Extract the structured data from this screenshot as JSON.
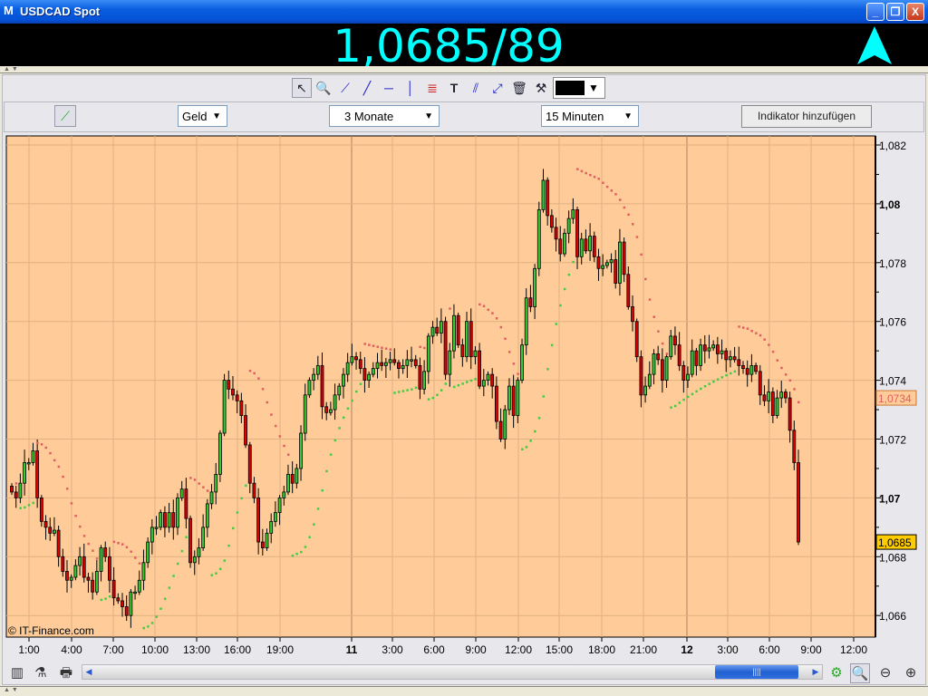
{
  "window": {
    "title": "USDCAD Spot",
    "logo": "M",
    "minimize": "_",
    "restore": "❐",
    "close": "X"
  },
  "quote": {
    "price": "1,0685/89",
    "direction": "up",
    "color": "#00ffff"
  },
  "strip": {
    "arrows": "▲ ▼"
  },
  "toolbar": {
    "icons": [
      "pointer-icon",
      "zoom-icon",
      "line-icon",
      "trend-line-icon",
      "horizontal-line-icon",
      "vertical-line-icon",
      "fibonacci-icon",
      "text-icon",
      "channel-icon",
      "arrow-line-icon",
      "trash-icon",
      "tools-icon"
    ],
    "color_value": "#000000"
  },
  "controls": {
    "price_type": "Geld",
    "range": "3 Monate",
    "interval": "15 Minuten",
    "add_indicator": "Indikator hinzufügen"
  },
  "chart_data": {
    "type": "candlestick",
    "watermark": "© IT-Finance.com",
    "ylim": [
      1.065,
      1.0825
    ],
    "y_ticks": [
      {
        "v": 1.066,
        "label": "1,066"
      },
      {
        "v": 1.068,
        "label": "1,068"
      },
      {
        "v": 1.07,
        "label": "1,07",
        "bold": true
      },
      {
        "v": 1.072,
        "label": "1,072"
      },
      {
        "v": 1.074,
        "label": "1,074"
      },
      {
        "v": 1.076,
        "label": "1,076"
      },
      {
        "v": 1.078,
        "label": "1,078"
      },
      {
        "v": 1.08,
        "label": "1,08",
        "bold": true
      },
      {
        "v": 1.082,
        "label": "1,082"
      }
    ],
    "x_ticks": [
      {
        "label": "1:00"
      },
      {
        "label": "4:00"
      },
      {
        "label": "7:00"
      },
      {
        "label": "10:00"
      },
      {
        "label": "13:00"
      },
      {
        "label": "16:00"
      },
      {
        "label": "19:00"
      },
      {
        "label": "11",
        "bold": true
      },
      {
        "label": "3:00"
      },
      {
        "label": "6:00"
      },
      {
        "label": "9:00"
      },
      {
        "label": "12:00"
      },
      {
        "label": "15:00"
      },
      {
        "label": "18:00"
      },
      {
        "label": "21:00"
      },
      {
        "label": "12",
        "bold": true
      },
      {
        "label": "3:00"
      },
      {
        "label": "6:00"
      },
      {
        "label": "9:00"
      },
      {
        "label": "12:00"
      }
    ],
    "indicator_label": {
      "value": 1.0734,
      "text": "1,0734"
    },
    "last_label": {
      "value": 1.0685,
      "text": "1,0685"
    },
    "overlay": "parabolic-sar",
    "colors": {
      "up": "#33cc33",
      "down": "#dd0000",
      "bg": "#ffcc99",
      "sar_up": "#44cc44",
      "sar_down": "#e06060"
    },
    "closes": [
      1.0702,
      1.07,
      1.0705,
      1.0712,
      1.0712,
      1.0716,
      1.07,
      1.0692,
      1.069,
      1.0688,
      1.0689,
      1.068,
      1.0675,
      1.0672,
      1.0673,
      1.0677,
      1.068,
      1.0673,
      1.0672,
      1.0668,
      1.0675,
      1.0683,
      1.068,
      1.0672,
      1.0666,
      1.0665,
      1.0663,
      1.066,
      1.0668,
      1.0668,
      1.0672,
      1.0678,
      1.0685,
      1.069,
      1.069,
      1.0695,
      1.069,
      1.0695,
      1.069,
      1.07,
      1.0703,
      1.0693,
      1.0678,
      1.068,
      1.0683,
      1.069,
      1.0698,
      1.0702,
      1.0708,
      1.0722,
      1.074,
      1.0737,
      1.0735,
      1.0733,
      1.0728,
      1.0718,
      1.0705,
      1.07,
      1.0685,
      1.0683,
      1.0688,
      1.0692,
      1.0695,
      1.07,
      1.0702,
      1.0708,
      1.0705,
      1.071,
      1.0722,
      1.0735,
      1.074,
      1.0742,
      1.0745,
      1.0731,
      1.0729,
      1.073,
      1.0735,
      1.0738,
      1.0742,
      1.0746,
      1.0748,
      1.0747,
      1.0744,
      1.074,
      1.0742,
      1.0744,
      1.0746,
      1.0745,
      1.0746,
      1.0747,
      1.0746,
      1.0744,
      1.0745,
      1.0747,
      1.0747,
      1.0745,
      1.0737,
      1.0743,
      1.0755,
      1.0758,
      1.0756,
      1.076,
      1.0742,
      1.075,
      1.0762,
      1.0752,
      1.0748,
      1.076,
      1.0748,
      1.075,
      1.0738,
      1.074,
      1.0742,
      1.0738,
      1.0726,
      1.072,
      1.073,
      1.0738,
      1.0728,
      1.074,
      1.0752,
      1.0768,
      1.0765,
      1.0778,
      1.0798,
      1.0808,
      1.0796,
      1.0792,
      1.0788,
      1.0783,
      1.079,
      1.0795,
      1.0798,
      1.0782,
      1.0788,
      1.0784,
      1.0789,
      1.0782,
      1.0778,
      1.0779,
      1.078,
      1.0781,
      1.0773,
      1.0787,
      1.0776,
      1.0765,
      1.076,
      1.0748,
      1.0735,
      1.0738,
      1.0742,
      1.0749,
      1.0747,
      1.074,
      1.0748,
      1.0755,
      1.0752,
      1.0745,
      1.074,
      1.0742,
      1.075,
      1.0745,
      1.0752,
      1.075,
      1.0751,
      1.0752,
      1.0749,
      1.075,
      1.0747,
      1.0748,
      1.0747,
      1.0745,
      1.0744,
      1.0742,
      1.0745,
      1.0743,
      1.0735,
      1.0733,
      1.0736,
      1.0728,
      1.0734,
      1.0736,
      1.0734,
      1.0723,
      1.0712,
      1.0685
    ]
  },
  "bottom_toolbar": {
    "icons": [
      "chart-type-icon",
      "indicators-icon",
      "print-icon",
      "scroll-left-icon",
      "scroll-right-icon",
      "settings-icon",
      "zoom-fit-icon",
      "zoom-out-icon",
      "zoom-in-icon"
    ],
    "scroll_position": 0.88
  }
}
